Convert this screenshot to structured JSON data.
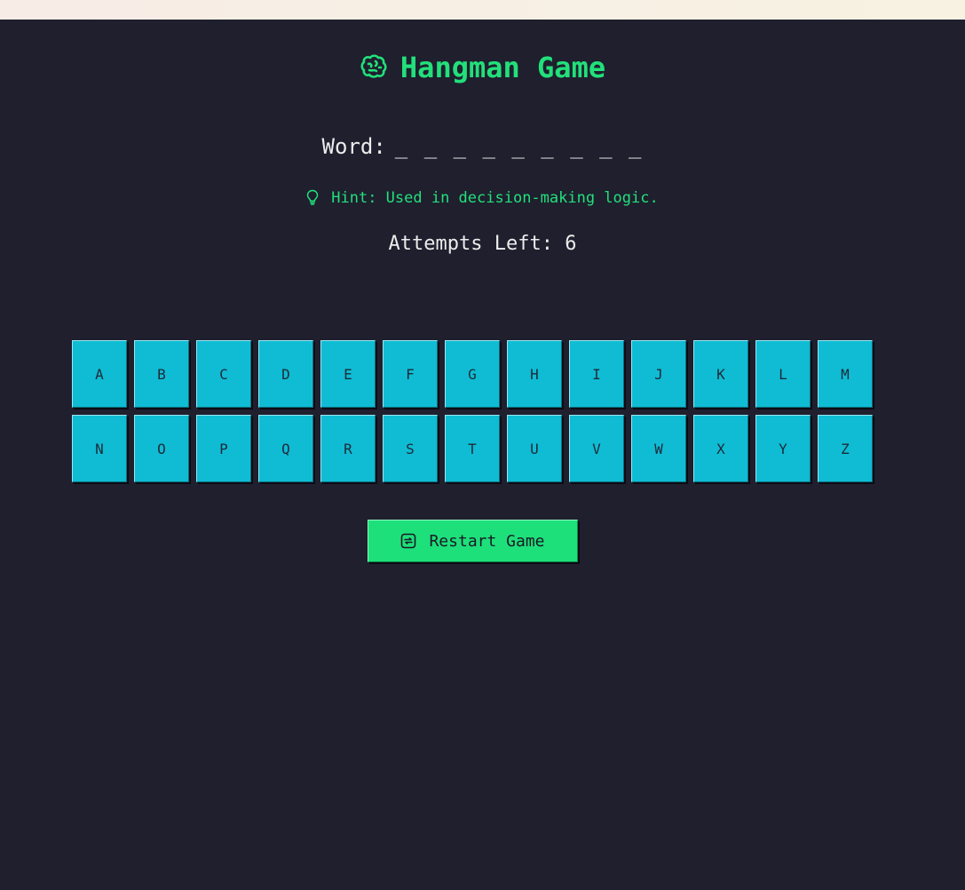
{
  "title": {
    "icon": "brain-icon",
    "text": "Hangman Game"
  },
  "word": {
    "label": "Word:",
    "display": "_ _ _ _ _ _ _ _ _"
  },
  "hint": {
    "icon": "lightbulb-icon",
    "text": "Hint: Used in decision-making logic."
  },
  "attempts": {
    "text": "Attempts Left: 6",
    "remaining": 6
  },
  "keyboard": {
    "letters": [
      "A",
      "B",
      "C",
      "D",
      "E",
      "F",
      "G",
      "H",
      "I",
      "J",
      "K",
      "L",
      "M",
      "N",
      "O",
      "P",
      "Q",
      "R",
      "S",
      "T",
      "U",
      "V",
      "W",
      "X",
      "Y",
      "Z"
    ]
  },
  "restart": {
    "icon": "restart-icon",
    "label": "Restart Game"
  },
  "colors": {
    "background": "#1f1f2e",
    "accent": "#22e07a",
    "key": "#0fbcd4",
    "text": "#ececec"
  }
}
